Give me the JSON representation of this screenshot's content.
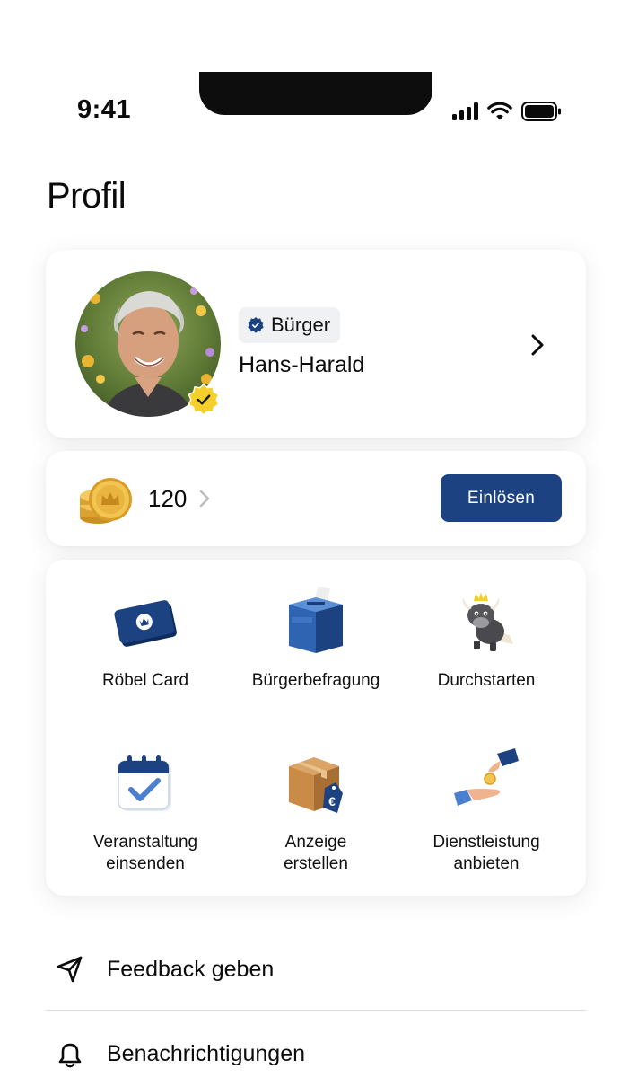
{
  "status_bar": {
    "time": "9:41"
  },
  "page": {
    "title": "Profil"
  },
  "profile": {
    "role_badge": "Bürger",
    "name": "Hans-Harald"
  },
  "coins": {
    "value": "120",
    "redeem_label": "Einlösen"
  },
  "features": {
    "items": [
      {
        "label": "Röbel Card",
        "icon": "card-icon"
      },
      {
        "label": "Bürgerbefragung",
        "icon": "ballot-box-icon"
      },
      {
        "label": "Durchstarten",
        "icon": "bull-mascot-icon"
      },
      {
        "label": "Veranstaltung\neinsenden",
        "icon": "calendar-check-icon"
      },
      {
        "label": "Anzeige\nerstellen",
        "icon": "package-price-icon"
      },
      {
        "label": "Dienstleistung\nanbieten",
        "icon": "hand-coin-icon"
      }
    ]
  },
  "menu": {
    "items": [
      {
        "label": "Feedback geben",
        "icon": "send-icon"
      },
      {
        "label": "Benachrichtigungen",
        "icon": "bell-icon"
      }
    ]
  },
  "colors": {
    "accent": "#1d4281",
    "badge_yellow": "#f5cf2a",
    "coin_gold": "#e7b33a"
  }
}
